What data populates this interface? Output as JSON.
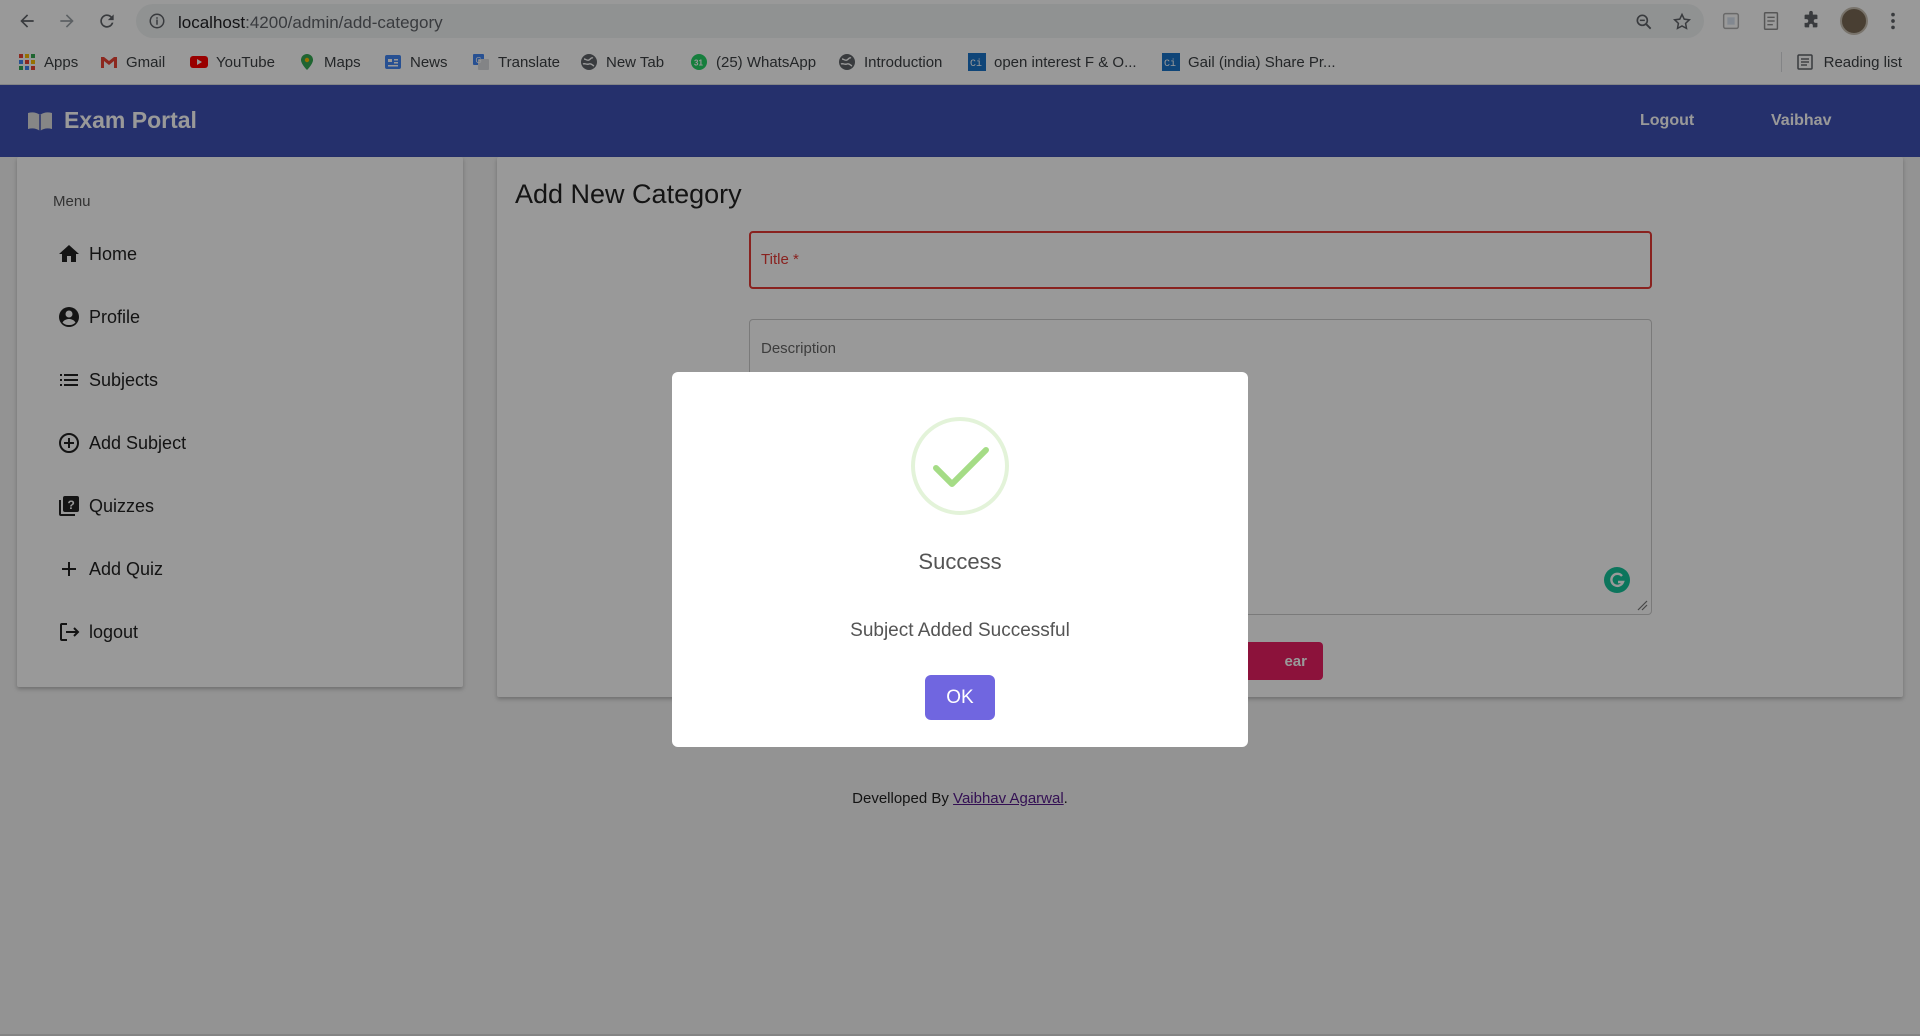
{
  "browser": {
    "url_host": "localhost",
    "url_path": ":4200/admin/add-category",
    "bookmarks": [
      {
        "label": "Apps",
        "icon": "apps-grid-icon"
      },
      {
        "label": "Gmail",
        "icon": "gmail-icon"
      },
      {
        "label": "YouTube",
        "icon": "youtube-icon"
      },
      {
        "label": "Maps",
        "icon": "maps-icon"
      },
      {
        "label": "News",
        "icon": "news-icon"
      },
      {
        "label": "Translate",
        "icon": "translate-icon"
      },
      {
        "label": "New Tab",
        "icon": "globe-icon"
      },
      {
        "label": "(25) WhatsApp",
        "icon": "whatsapp-icon"
      },
      {
        "label": "Introduction",
        "icon": "globe-icon"
      },
      {
        "label": "open interest F & O...",
        "icon": "ci-icon"
      },
      {
        "label": "Gail (india) Share Pr...",
        "icon": "ci-icon"
      }
    ],
    "reading_list": "Reading list"
  },
  "app": {
    "brand": "Exam Portal",
    "logout_link": "Logout",
    "user_link": "Vaibhav",
    "accent": "#3f51b5"
  },
  "sidebar": {
    "header": "Menu",
    "items": [
      {
        "label": "Home",
        "icon": "home-icon"
      },
      {
        "label": "Profile",
        "icon": "account-circle-icon"
      },
      {
        "label": "Subjects",
        "icon": "list-icon"
      },
      {
        "label": "Add Subject",
        "icon": "add-circle-icon"
      },
      {
        "label": "Quizzes",
        "icon": "quiz-icon"
      },
      {
        "label": "Add Quiz",
        "icon": "plus-icon"
      },
      {
        "label": "logout",
        "icon": "logout-icon"
      }
    ]
  },
  "form": {
    "title": "Add New Category",
    "title_field_label": "Title *",
    "description_field_label": "Description",
    "clear_button_label": "ear",
    "clear_color": "#e91e63"
  },
  "footer": {
    "prefix": "Develloped By ",
    "author": "Vaibhav Agarwal",
    "suffix": "."
  },
  "modal": {
    "title": "Success",
    "message": "Subject Added Successful",
    "ok_label": "OK",
    "ok_color": "#7066e0",
    "success_color": "#a5dc86"
  }
}
